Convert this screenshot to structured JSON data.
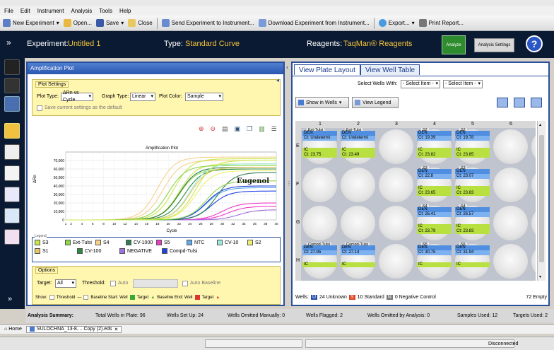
{
  "menu": [
    "File",
    "Edit",
    "Instrument",
    "Analysis",
    "Tools",
    "Help"
  ],
  "toolbar": {
    "new_experiment": "New Experiment",
    "open": "Open...",
    "save": "Save",
    "close": "Close",
    "send": "Send Experiment to Instrument...",
    "download": "Download Experiment from Instrument...",
    "export": "Export...",
    "print": "Print Report..."
  },
  "experiment": {
    "label": "Experiment:",
    "name": "Untitled 1",
    "type_label": "Type:",
    "type": "Standard Curve",
    "reagents_label": "Reagents:",
    "reagents": "TaqMan® Reagents",
    "analyze": "Analyze",
    "analysis_settings": "Analysis Settings",
    "help": "?"
  },
  "amp": {
    "title": "Amplification Plot",
    "plot_settings": "Plot Settings",
    "plot_type_label": "Plot Type:",
    "plot_type": "ΔRn vs Cycle",
    "graph_type_label": "Graph Type:",
    "graph_type": "Linear",
    "plot_color_label": "Plot Color:",
    "plot_color": "Sample",
    "save_default": "Save current settings as the default"
  },
  "legend_title": "Legend",
  "legend": [
    {
      "name": "S3",
      "color": "#c8e84a"
    },
    {
      "name": "Ext-Tulsi",
      "color": "#8fd648"
    },
    {
      "name": "S4",
      "color": "#f7d08a"
    },
    {
      "name": "CV-1000",
      "color": "#2e7d4f"
    },
    {
      "name": "S5",
      "color": "#f238c8"
    },
    {
      "name": "NTC",
      "color": "#60a8e8"
    },
    {
      "name": "CV-10",
      "color": "#9ae8e0"
    },
    {
      "name": "S2",
      "color": "#f0f070"
    },
    {
      "name": "S1",
      "color": "#e8c860"
    },
    {
      "name": "CV-100",
      "color": "#2a8a3e"
    },
    {
      "name": "NEGATIVE",
      "color": "#a070e0"
    },
    {
      "name": "Compd-Tulsi",
      "color": "#2040e0"
    }
  ],
  "options": {
    "title": "Options",
    "target_label": "Target:",
    "target": "All",
    "threshold_label": "Threshold:",
    "auto": "Auto",
    "auto_baseline": "Auto Baseline",
    "show_label": "Show:",
    "threshold": "Threshold",
    "baseline_start": "Baseline Start: Well",
    "target_word": "Target",
    "baseline_end": "Baseline End: Well",
    "target_word2": "Target"
  },
  "chart_data": {
    "type": "line",
    "title": "Amplification Plot",
    "xlabel": "Cycle",
    "ylabel": "ΔRn",
    "xlim": [
      1,
      40
    ],
    "ylim": [
      0,
      80000
    ],
    "yticks": [
      "0",
      "10,000",
      "20,000",
      "30,000",
      "40,000",
      "50,000",
      "60,000",
      "70,000"
    ],
    "xticks": [
      "1",
      "2",
      "4",
      "6",
      "8",
      "10",
      "12",
      "14",
      "16",
      "18",
      "20",
      "22",
      "24",
      "26",
      "28",
      "30",
      "32",
      "34",
      "36",
      "38",
      "40"
    ],
    "annotation": "Eugenol",
    "grid": true,
    "curves": [
      {
        "color": "#f7d08a",
        "ct": 18,
        "plateau": 74000
      },
      {
        "color": "#f7d08a",
        "ct": 19,
        "plateau": 70000
      },
      {
        "color": "#c8e84a",
        "ct": 21,
        "plateau": 72000
      },
      {
        "color": "#c8e84a",
        "ct": 22,
        "plateau": 66000
      },
      {
        "color": "#8fd648",
        "ct": 20,
        "plateau": 64000
      },
      {
        "color": "#8fd648",
        "ct": 22,
        "plateau": 60000
      },
      {
        "color": "#2e7d4f",
        "ct": 22,
        "plateau": 62000
      },
      {
        "color": "#2a8a3e",
        "ct": 23,
        "plateau": 60000
      },
      {
        "color": "#9ae8e0",
        "ct": 24,
        "plateau": 66000
      },
      {
        "color": "#e8c860",
        "ct": 24,
        "plateau": 62000
      },
      {
        "color": "#f0f070",
        "ct": 25,
        "plateau": 58000
      },
      {
        "color": "#60a8e8",
        "ct": 27,
        "plateau": 38000
      },
      {
        "color": "#2040e0",
        "ct": 27,
        "plateau": 40000
      },
      {
        "color": "#2040e0",
        "ct": 28,
        "plateau": 34000
      },
      {
        "color": "#f238c8",
        "ct": 30,
        "plateau": 20000
      },
      {
        "color": "#f238c8",
        "ct": 31,
        "plateau": 16000
      },
      {
        "color": "#a070e0",
        "ct": 33,
        "plateau": 12000
      },
      {
        "color": "#2e7d4f",
        "ct": 29,
        "plateau": 56000
      },
      {
        "color": "#8fd648",
        "ct": 27,
        "plateau": 46000
      },
      {
        "color": "#c8e84a",
        "ct": 25,
        "plateau": 70000
      }
    ]
  },
  "right": {
    "tab1": "View Plate Layout",
    "tab2": "View Well Table",
    "select_wells": "Select Wells With:",
    "select_item1": "- Select Item -",
    "select_item2": "- Select Item -",
    "show_in_wells": "Show in Wells",
    "view_legend": "View Legend",
    "cols": [
      "1",
      "2",
      "3",
      "4",
      "5",
      "6"
    ],
    "rows": [
      "E",
      "F",
      "G",
      "H"
    ],
    "wells": [
      {
        "label": "Ext-Tulsi",
        "r": 0,
        "c": 0,
        "ct": "Ct: Undetermi",
        "ic": "Ct: 23.75"
      },
      {
        "label": "Ext-Tulsi",
        "r": 0,
        "c": 1,
        "ct": "Ct: Undetermi",
        "ic": "Ct: 23.49"
      },
      {
        "label": "S2",
        "r": 0,
        "c": 3,
        "ct": "Ct: 19.39",
        "ic": "Ct: 23.82"
      },
      {
        "label": "S2",
        "r": 0,
        "c": 4,
        "ct": "Ct: 19.78",
        "ic": "Ct: 23.85"
      },
      {
        "label": "S3",
        "r": 1,
        "c": 3,
        "ct": "Ct: 22.8",
        "ic": "Ct: 23.65"
      },
      {
        "label": "S3",
        "r": 1,
        "c": 4,
        "ct": "Ct: 23.07",
        "ic": "Ct: 23.83"
      },
      {
        "label": "S4",
        "r": 2,
        "c": 3,
        "ct": "Ct: 26.41",
        "ic": "Ct: 23.79"
      },
      {
        "label": "S4",
        "r": 2,
        "c": 4,
        "ct": "Ct: 26.57",
        "ic": "Ct: 23.83"
      },
      {
        "label": "Compd-Tulsi",
        "r": 3,
        "c": 0,
        "ct": "Ct: 27.95",
        "ic": ""
      },
      {
        "label": "Compd-Tulsi",
        "r": 3,
        "c": 1,
        "ct": "Ct: 27.14",
        "ic": ""
      },
      {
        "label": "S5",
        "r": 3,
        "c": 3,
        "ct": "Ct: 30.75",
        "ic": ""
      },
      {
        "label": "S5",
        "r": 3,
        "c": 4,
        "ct": "Ct: 31.94",
        "ic": ""
      }
    ],
    "den": "DEN",
    "ic": "IC",
    "wells_label": "Wells:",
    "u": "U",
    "unknown": "24 Unknown",
    "s": "S",
    "standard": "10 Standard",
    "n": "N",
    "neg": "0 Negative Control",
    "empty": "72 Empty"
  },
  "summary": {
    "title": "Analysis Summary:",
    "total": "Total Wells in Plate: 96",
    "setup": "Wells Set Up: 24",
    "omitted": "Wells Omitted Manually: 0",
    "flagged": "Wells Flagged: 2",
    "omitted_analysis": "Wells Omitted by Analysis: 0",
    "samples": "Samples Used: 12",
    "targets": "Targets Used: 2"
  },
  "tabs": {
    "home": "Home",
    "file": "SULOCHNA_13-8.... Copy (2).eds"
  },
  "status": {
    "connection": "Disconnected"
  }
}
